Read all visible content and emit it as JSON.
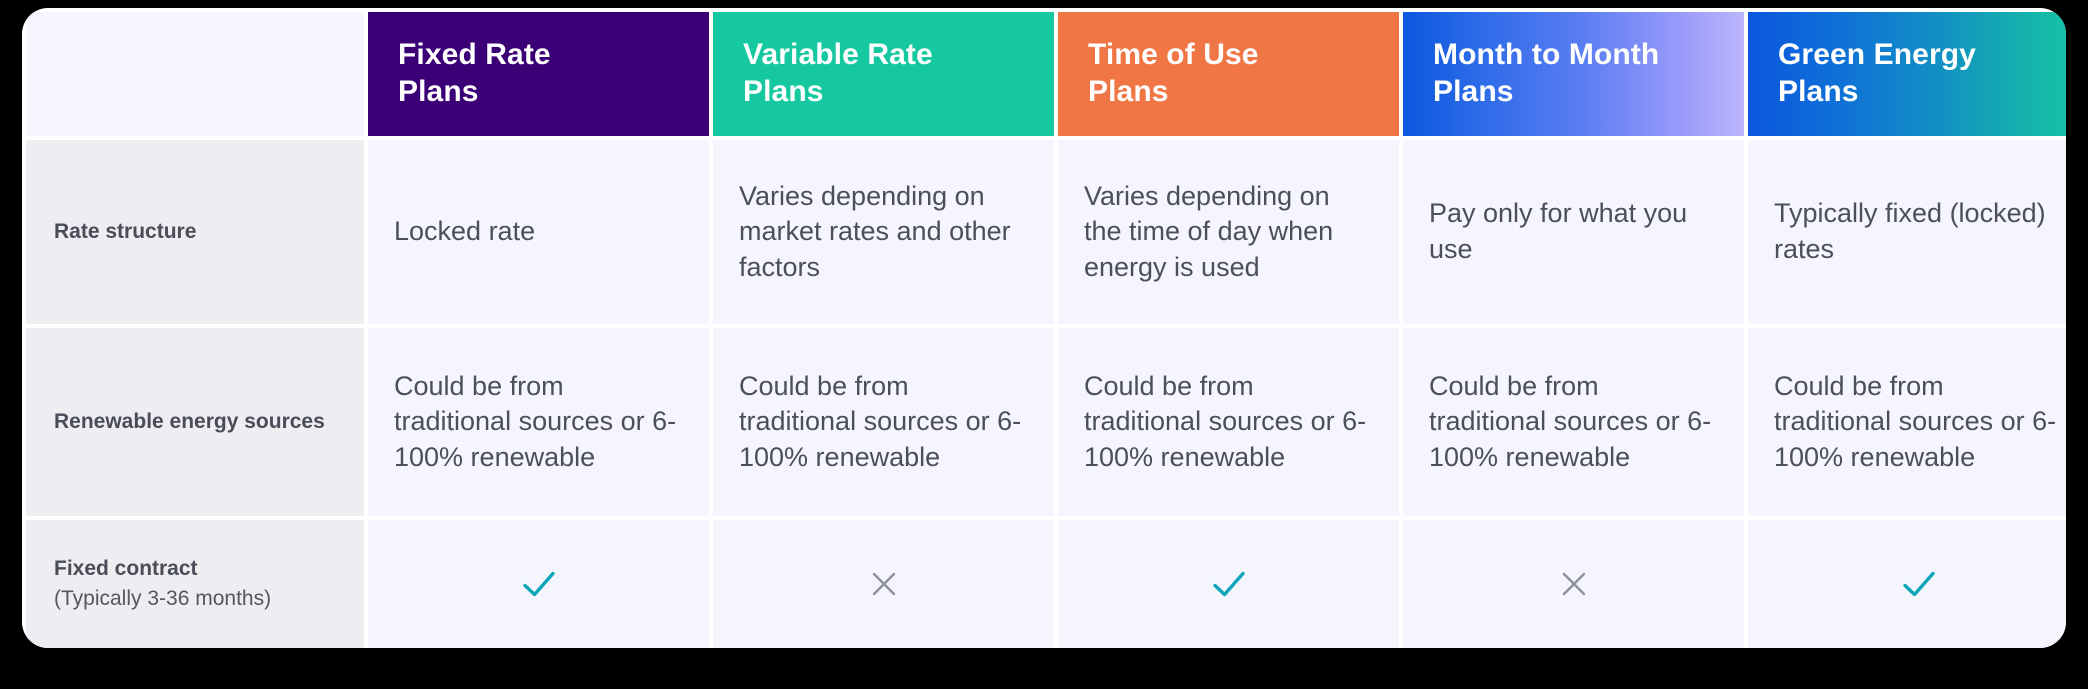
{
  "card": {
    "background": "#F5F5FD",
    "page_background": "#000000"
  },
  "colors": {
    "fixed_rate": "#3B0075",
    "variable_rate": "#15C8A0",
    "time_of_use": "#F07645",
    "month_to_month_start": "#0B5CE0",
    "month_to_month_end": "#B3B0FB",
    "green_energy_start": "#0B5CE0",
    "green_energy_end": "#17C9A3",
    "check": "#0FA5B8",
    "cross": "#8E9099",
    "label_bg": "#EDEDF2",
    "cell_bg": "#F5F5FD",
    "text": "#4C4F5A",
    "label_text": "#4A4D58"
  },
  "table": {
    "corner_label": "",
    "columns": [
      {
        "id": "fixed-rate",
        "title": "Fixed Rate\nPlans",
        "label": "Fixed Rate Plans"
      },
      {
        "id": "variable-rate",
        "title": "Variable Rate\nPlans",
        "label": "Variable Rate Plans"
      },
      {
        "id": "time-of-use",
        "title": "Time of Use\nPlans",
        "label": "Time of Use Plans"
      },
      {
        "id": "month-to-month",
        "title": "Month to Month\nPlans",
        "label": "Month to Month Plans"
      },
      {
        "id": "green-energy",
        "title": "Green Energy\nPlans",
        "label": "Green Energy Plans"
      }
    ],
    "column_titles": {
      "fixed_rate_line1": "Fixed Rate",
      "fixed_rate_line2": "Plans",
      "variable_rate_line1": "Variable Rate",
      "variable_rate_line2": "Plans",
      "time_of_use_line1": "Time of Use",
      "time_of_use_line2": "Plans",
      "month_to_month_line1": "Month to Month",
      "month_to_month_line2": "Plans",
      "green_energy_line1": "Green Energy",
      "green_energy_line2": "Plans"
    },
    "rows": [
      {
        "id": "rate-structure",
        "label": "Rate structure",
        "sublabel": "",
        "type": "text",
        "cells": [
          "Locked rate",
          "Varies depending on market rates and other factors",
          "Varies depending on the time of day when energy is used",
          "Pay only for what you use",
          "Typically fixed (locked) rates"
        ]
      },
      {
        "id": "renewable-energy-sources",
        "label": "Renewable energy sources",
        "sublabel": "",
        "type": "text",
        "cells": [
          "Could be from traditional sources or 6-100% renewable",
          "Could be from traditional sources or 6-100% renewable",
          "Could be from traditional sources or 6-100% renewable",
          "Could be from traditional sources or 6-100% renewable",
          "Could be from traditional sources or 6-100% renewable"
        ]
      },
      {
        "id": "fixed-contract",
        "label": "Fixed contract",
        "sublabel": "(Typically 3-36 months)",
        "type": "icon",
        "cells": [
          "check",
          "cross",
          "check",
          "cross",
          "check"
        ]
      }
    ]
  }
}
